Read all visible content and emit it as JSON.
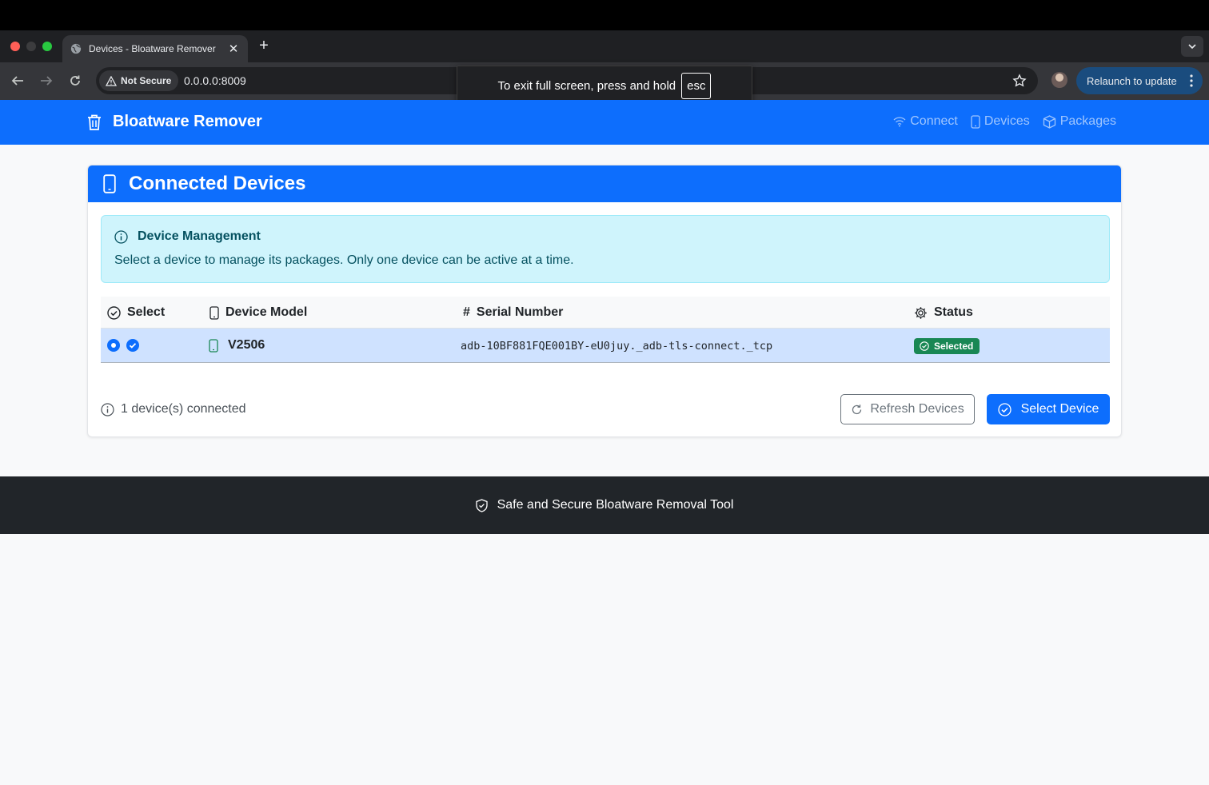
{
  "browser": {
    "tab_title": "Devices - Bloatware Remover",
    "security_label": "Not Secure",
    "url": "0.0.0.0:8009",
    "relaunch_label": "Relaunch to update",
    "fullscreen_notice": "To exit full screen, press and hold",
    "fullscreen_key": "esc"
  },
  "navbar": {
    "brand": "Bloatware Remover",
    "links": [
      "Connect",
      "Devices",
      "Packages"
    ]
  },
  "card": {
    "title": "Connected Devices",
    "alert_title": "Device Management",
    "alert_text": "Select a device to manage its packages. Only one device can be active at a time.",
    "columns": [
      "Select",
      "Device Model",
      "Serial Number",
      "Status"
    ],
    "column_hash": "#",
    "rows": [
      {
        "selected": true,
        "model": "V2506",
        "serial": "adb-10BF881FQE001BY-eU0juy._adb-tls-connect._tcp",
        "status": "Selected"
      }
    ],
    "device_count": "1 device(s) connected",
    "refresh_label": "Refresh Devices",
    "select_label": "Select Device"
  },
  "footer": {
    "text": "Safe and Secure Bloatware Removal Tool"
  },
  "colors": {
    "primary": "#0d6efd",
    "success": "#198754",
    "info_bg": "#cff4fc",
    "dark": "#212529"
  }
}
